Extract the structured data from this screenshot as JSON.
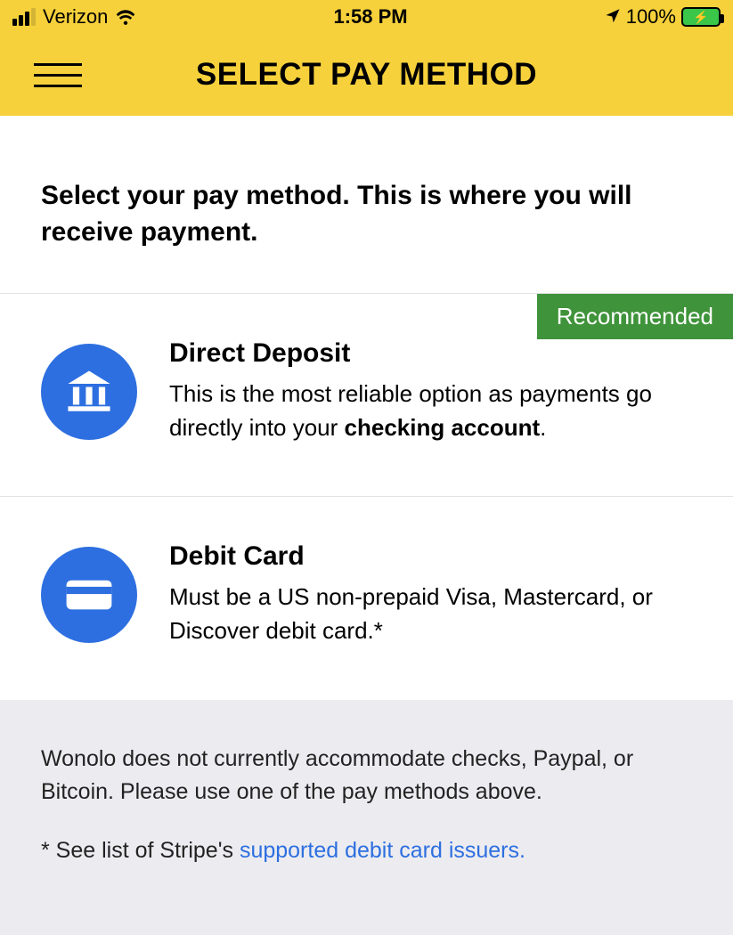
{
  "status": {
    "carrier": "Verizon",
    "time": "1:58 PM",
    "battery_pct": "100%"
  },
  "header": {
    "title": "SELECT PAY METHOD"
  },
  "intro": {
    "text": "Select your pay method. This is where you will receive payment."
  },
  "options": {
    "direct_deposit": {
      "badge": "Recommended",
      "title": "Direct Deposit",
      "desc_prefix": "This is the most reliable option as payments go directly into your ",
      "desc_bold": "checking account",
      "desc_suffix": "."
    },
    "debit_card": {
      "title": "Debit Card",
      "desc": "Must be a US non-prepaid Visa, Mastercard, or Discover debit card.*"
    }
  },
  "footer": {
    "note": "Wonolo does not currently accommodate checks, Paypal, or Bitcoin. Please use one of the pay methods above.",
    "asterisk_prefix": "* See list of Stripe's ",
    "link_text": "supported debit card issuers."
  }
}
